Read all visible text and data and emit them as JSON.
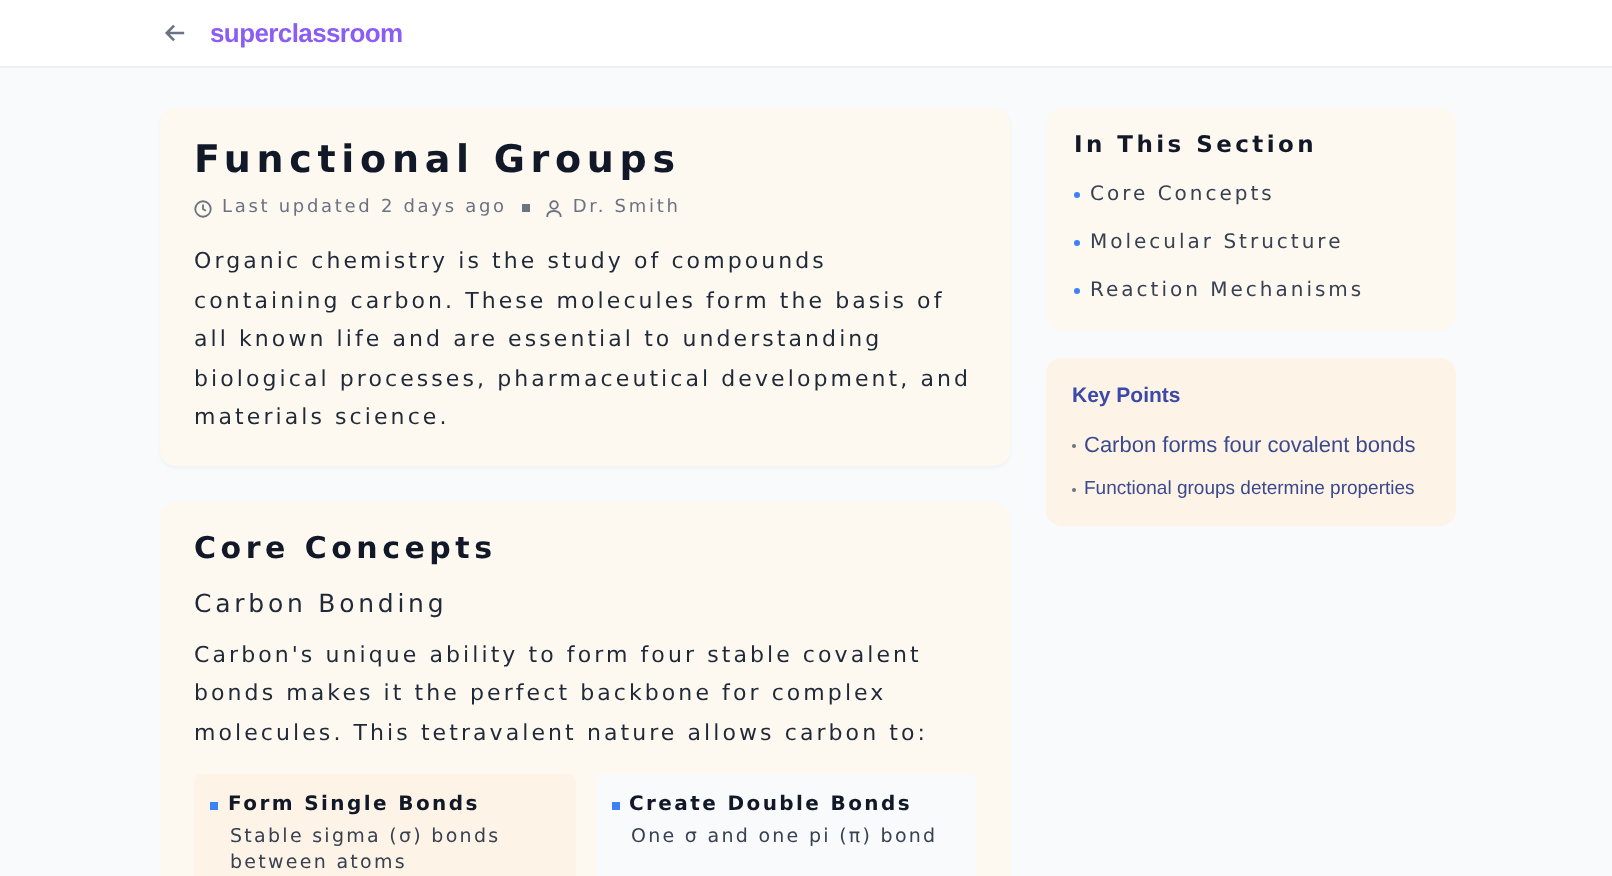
{
  "header": {
    "brand": "superclassroom"
  },
  "article": {
    "title": "Functional Groups",
    "updated": "Last updated 2 days ago",
    "author": "Dr. Smith",
    "intro": "Organic chemistry is the study of compounds containing carbon. These molecules form the basis of all known life and are essential to understanding biological processes, pharmaceutical development, and materials science."
  },
  "section": {
    "title": "Core Concepts",
    "subtitle": "Carbon Bonding",
    "text": "Carbon's unique ability to form four stable covalent bonds makes it the perfect backbone for complex molecules. This tetravalent nature allows carbon to:",
    "cards": [
      {
        "title": "Form Single Bonds",
        "text": "Stable sigma (σ) bonds between atoms",
        "color": "#fdf3e6"
      },
      {
        "title": "Create Double Bonds",
        "text": "One σ and one pi (π) bond",
        "color": "#f8fafc"
      }
    ]
  },
  "toc": {
    "title": "In This Section",
    "items": [
      "Core Concepts",
      "Molecular Structure",
      "Reaction Mechanisms"
    ]
  },
  "key_points": {
    "title": "Key Points",
    "items": [
      "Carbon forms four covalent bonds",
      "Functional groups determine properties"
    ]
  }
}
